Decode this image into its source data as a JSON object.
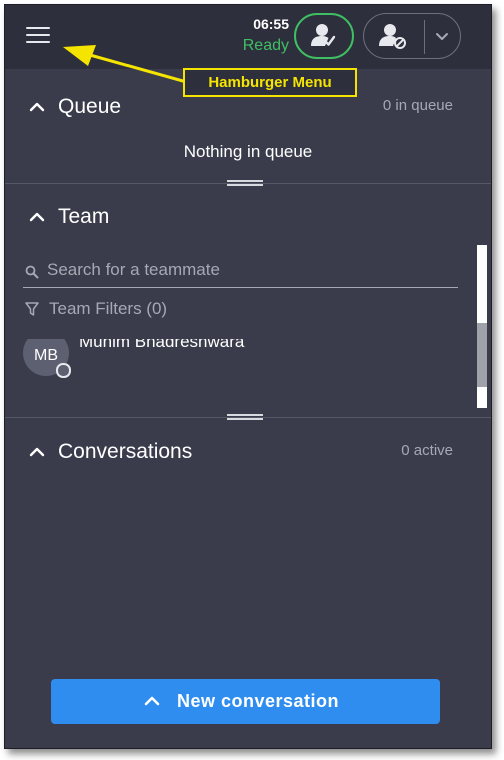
{
  "header": {
    "time": "06:55",
    "status": "Ready"
  },
  "callout": {
    "label": "Hamburger Menu"
  },
  "queue": {
    "title": "Queue",
    "count": "0 in queue",
    "empty": "Nothing in queue"
  },
  "team": {
    "title": "Team",
    "search_placeholder": "Search for a teammate",
    "filters": "Team Filters (0)",
    "member": {
      "initials": "MB",
      "name": "Muhim Bhadreshwara"
    }
  },
  "conversations": {
    "title": "Conversations",
    "count": "0 active"
  },
  "footer": {
    "new_conversation": "New conversation"
  },
  "colors": {
    "panel": "#3a3c4b",
    "header": "#2d2f3c",
    "ready": "#3fbf63",
    "accent": "#2f8df0",
    "callout": "#f5e400"
  },
  "icons": [
    "hamburger-icon",
    "agent-available-icon",
    "agent-offline-icon",
    "chevron-down-icon",
    "chevron-up-icon",
    "search-icon",
    "filter-icon"
  ]
}
